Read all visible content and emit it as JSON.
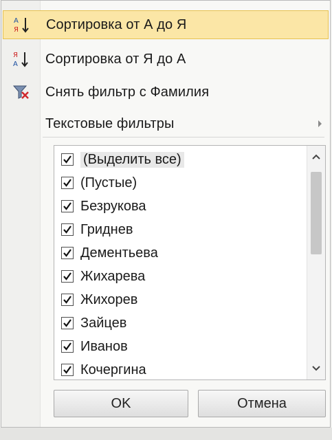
{
  "menu": {
    "items": [
      {
        "label": "Сортировка от А до Я",
        "icon": "sort-a-to-z-icon",
        "highlighted": true,
        "submenu": false
      },
      {
        "label": "Сортировка от Я до А",
        "icon": "sort-z-to-a-icon",
        "highlighted": false,
        "submenu": false
      },
      {
        "label": "Снять фильтр с Фамилия",
        "icon": "clear-filter-icon",
        "highlighted": false,
        "submenu": false
      },
      {
        "label": "Текстовые фильтры",
        "icon": "",
        "highlighted": false,
        "submenu": true
      }
    ]
  },
  "filter_list": {
    "items": [
      {
        "label": "(Выделить все)",
        "checked": true
      },
      {
        "label": "(Пустые)",
        "checked": true
      },
      {
        "label": "Безрукова",
        "checked": true
      },
      {
        "label": "Гриднев",
        "checked": true
      },
      {
        "label": "Дементьева",
        "checked": true
      },
      {
        "label": "Жихарева",
        "checked": true
      },
      {
        "label": "Жихорев",
        "checked": true
      },
      {
        "label": "Зайцев",
        "checked": true
      },
      {
        "label": "Иванов",
        "checked": true
      },
      {
        "label": "Кочергина",
        "checked": true
      }
    ]
  },
  "buttons": {
    "ok_label": "OK",
    "cancel_label": "Отмена"
  },
  "colors": {
    "highlight": "#fbe6a6",
    "highlight_border": "#e7c14f",
    "checkmark": "#111111"
  }
}
